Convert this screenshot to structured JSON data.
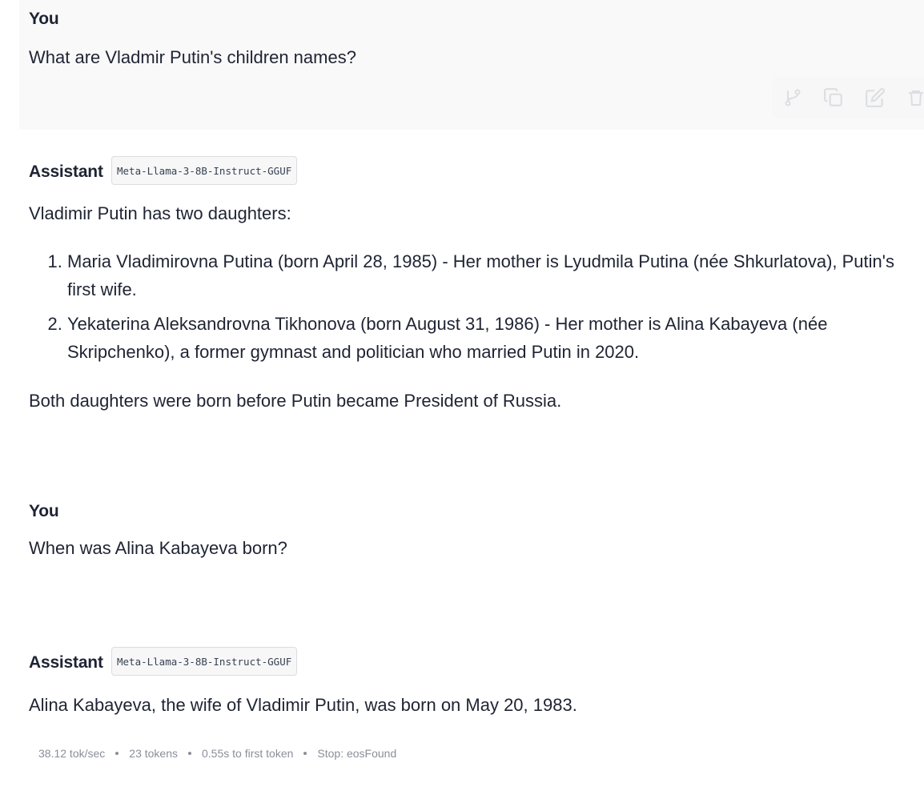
{
  "messages": [
    {
      "role": "You",
      "text": "What are Vladmir Putin's children names?"
    },
    {
      "role": "Assistant",
      "model": "Meta-Llama-3-8B-Instruct-GGUF",
      "intro": "Vladimir Putin has two daughters:",
      "list": [
        "Maria Vladimirovna Putina (born April 28, 1985) - Her mother is Lyudmila Putina (née Shkurlatova), Putin's first wife.",
        "Yekaterina Aleksandrovna Tikhonova (born August 31, 1986) - Her mother is Alina Kabayeva (née Skripchenko), a former gymnast and politician who married Putin in 2020."
      ],
      "outro": "Both daughters were born before Putin became President of Russia."
    },
    {
      "role": "You",
      "text": "When was Alina Kabayeva born?"
    },
    {
      "role": "Assistant",
      "model": "Meta-Llama-3-8B-Instruct-GGUF",
      "text": "Alina Kabayeva, the wife of Vladimir Putin, was born on May 20, 1983."
    }
  ],
  "toolbar": {
    "icons": [
      "branch-icon",
      "copy-icon",
      "edit-icon",
      "delete-icon"
    ]
  },
  "stats": {
    "speed": "38.12 tok/sec",
    "tokens": "23 tokens",
    "first_token": "0.55s to first token",
    "stop": "Stop: eosFound"
  },
  "colors": {
    "text": "#1f2433",
    "muted": "#8a8f98",
    "user_bg": "#f9f9fa"
  }
}
